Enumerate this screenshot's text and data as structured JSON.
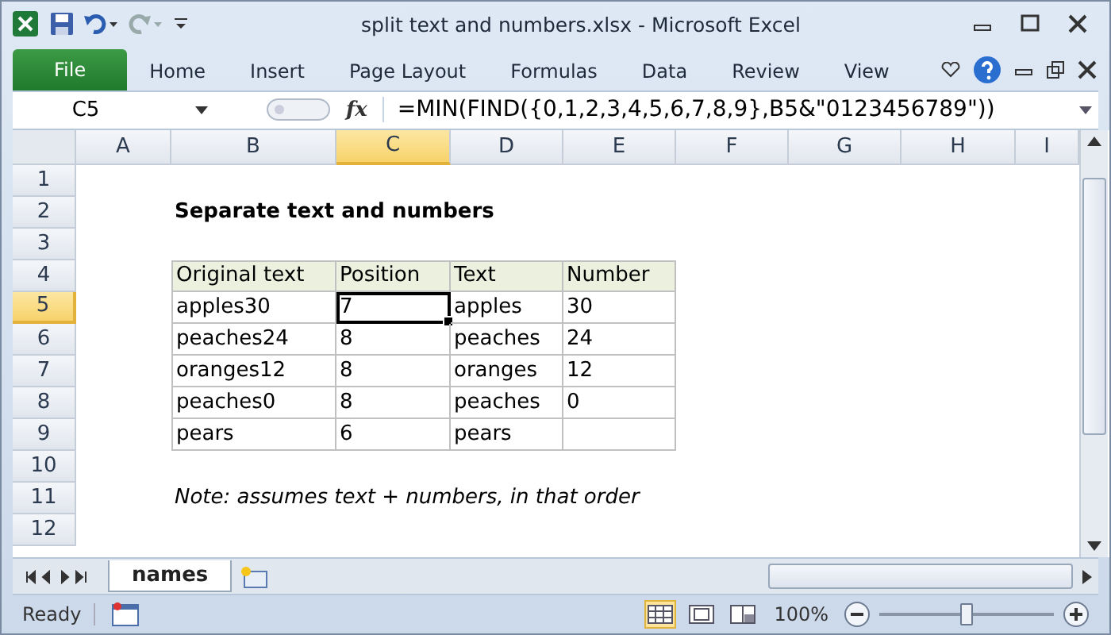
{
  "window": {
    "title": "split text and numbers.xlsx  -  Microsoft Excel"
  },
  "ribbon_tabs": [
    {
      "label": "File",
      "kind": "file",
      "selected": false
    },
    {
      "label": "Home",
      "kind": "tab",
      "selected": false
    },
    {
      "label": "Insert",
      "kind": "tab",
      "selected": false
    },
    {
      "label": "Page Layout",
      "kind": "tab",
      "selected": false
    },
    {
      "label": "Formulas",
      "kind": "tab",
      "selected": false
    },
    {
      "label": "Data",
      "kind": "tab",
      "selected": false
    },
    {
      "label": "Review",
      "kind": "tab",
      "selected": false
    },
    {
      "label": "View",
      "kind": "tab",
      "selected": false
    }
  ],
  "formula_bar": {
    "name_box": "C5",
    "fx": "fx",
    "formula": "=MIN(FIND({0,1,2,3,4,5,6,7,8,9},B5&\"0123456789\"))"
  },
  "columns": [
    {
      "label": "A",
      "selected": false
    },
    {
      "label": "B",
      "selected": false
    },
    {
      "label": "C",
      "selected": true
    },
    {
      "label": "D",
      "selected": false
    },
    {
      "label": "E",
      "selected": false
    },
    {
      "label": "F",
      "selected": false
    },
    {
      "label": "G",
      "selected": false
    },
    {
      "label": "H",
      "selected": false
    },
    {
      "label": "I",
      "selected": false
    }
  ],
  "rows": [
    {
      "header": "1",
      "selected": false,
      "kind": "blank"
    },
    {
      "header": "2",
      "selected": false,
      "kind": "title",
      "text": "Separate text and numbers"
    },
    {
      "header": "3",
      "selected": false,
      "kind": "blank"
    },
    {
      "header": "4",
      "selected": false,
      "kind": "table_header",
      "cells": [
        "Original text",
        "Position",
        "Text",
        "Number"
      ]
    },
    {
      "header": "5",
      "selected": true,
      "kind": "table_row",
      "cells": [
        {
          "text": "apples30",
          "selected": false
        },
        {
          "text": "7",
          "selected": true
        },
        {
          "text": "apples",
          "selected": false
        },
        {
          "text": "30",
          "selected": false
        }
      ]
    },
    {
      "header": "6",
      "selected": false,
      "kind": "table_row",
      "cells": [
        {
          "text": "peaches24",
          "selected": false
        },
        {
          "text": "8",
          "selected": false
        },
        {
          "text": "peaches",
          "selected": false
        },
        {
          "text": "24",
          "selected": false
        }
      ]
    },
    {
      "header": "7",
      "selected": false,
      "kind": "table_row",
      "cells": [
        {
          "text": "oranges12",
          "selected": false
        },
        {
          "text": "8",
          "selected": false
        },
        {
          "text": "oranges",
          "selected": false
        },
        {
          "text": "12",
          "selected": false
        }
      ]
    },
    {
      "header": "8",
      "selected": false,
      "kind": "table_row",
      "cells": [
        {
          "text": "peaches0",
          "selected": false
        },
        {
          "text": "8",
          "selected": false
        },
        {
          "text": "peaches",
          "selected": false
        },
        {
          "text": "0",
          "selected": false
        }
      ]
    },
    {
      "header": "9",
      "selected": false,
      "kind": "table_row",
      "cells": [
        {
          "text": "pears",
          "selected": false
        },
        {
          "text": "6",
          "selected": false
        },
        {
          "text": "pears",
          "selected": false
        },
        {
          "selected": false
        }
      ]
    },
    {
      "header": "10",
      "selected": false,
      "kind": "blank"
    },
    {
      "header": "11",
      "selected": false,
      "kind": "note",
      "text": "Note: assumes text + numbers, in that order"
    },
    {
      "header": "12",
      "selected": false,
      "kind": "blank"
    }
  ],
  "sheet_tabs": [
    {
      "label": "names",
      "selected": true
    }
  ],
  "status_bar": {
    "status": "Ready",
    "views": [
      {
        "kind": "normal",
        "selected": true
      },
      {
        "kind": "page_layout",
        "selected": false
      },
      {
        "kind": "page_break",
        "selected": false
      }
    ],
    "zoom": "100%",
    "zoom_level": {
      "level": 0.5
    }
  }
}
